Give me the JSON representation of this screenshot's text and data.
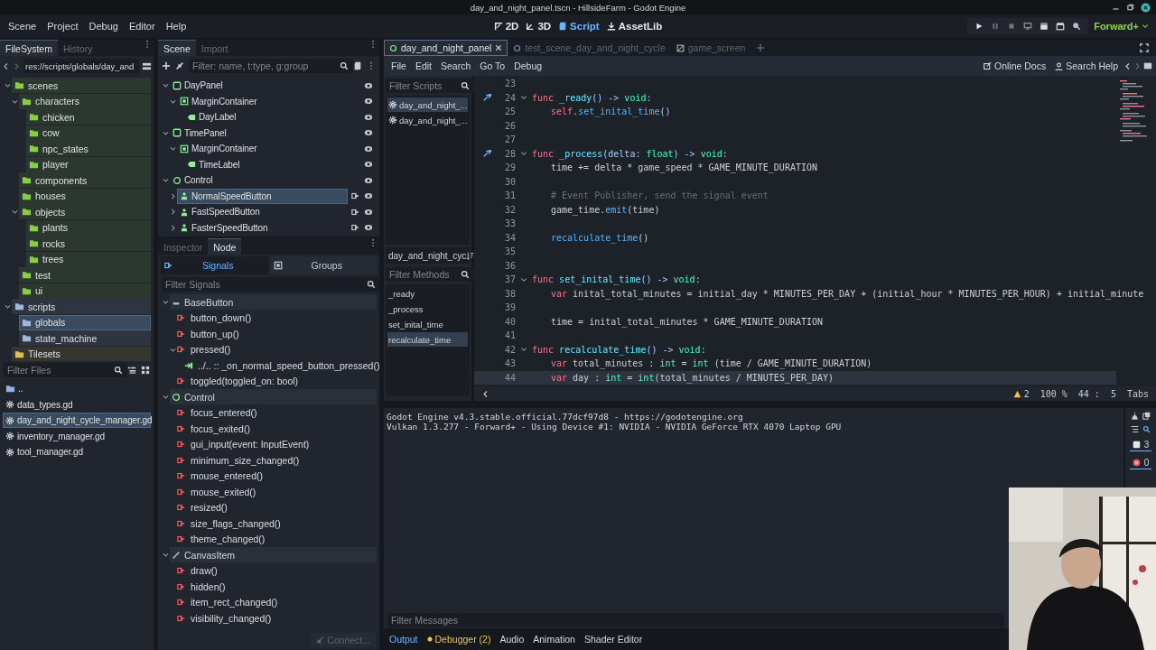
{
  "window": {
    "title": "day_and_night_panel.tscn - HillsideFarm - Godot Engine"
  },
  "menu": [
    "Scene",
    "Project",
    "Debug",
    "Editor",
    "Help"
  ],
  "workspaces": [
    {
      "label": "2D",
      "kind": "flat",
      "selected": false
    },
    {
      "label": "3D",
      "kind": "spatial",
      "selected": false
    },
    {
      "label": "Script",
      "kind": "script",
      "selected": true
    },
    {
      "label": "AssetLib",
      "kind": "assetlib",
      "selected": false
    }
  ],
  "renderer": "Forward+",
  "filesystem": {
    "tabs": [
      {
        "label": "FileSystem",
        "selected": true
      },
      {
        "label": "History",
        "selected": false
      }
    ],
    "path": "res://scripts/globals/day_and",
    "tree": [
      {
        "name": "scenes",
        "color": "#86d13f",
        "expanded": true,
        "selected": false,
        "children": [
          {
            "name": "characters",
            "expanded": true,
            "selected": false,
            "children": [
              {
                "name": "chicken",
                "selected": false
              },
              {
                "name": "cow",
                "selected": false
              },
              {
                "name": "npc_states",
                "selected": false
              },
              {
                "name": "player",
                "selected": false
              }
            ]
          },
          {
            "name": "components",
            "selected": false
          },
          {
            "name": "houses",
            "selected": false
          },
          {
            "name": "objects",
            "expanded": true,
            "selected": false,
            "children": [
              {
                "name": "plants",
                "selected": false
              },
              {
                "name": "rocks",
                "selected": false
              },
              {
                "name": "trees",
                "selected": false
              }
            ]
          },
          {
            "name": "test",
            "selected": false
          },
          {
            "name": "ui",
            "selected": false
          }
        ]
      },
      {
        "name": "scripts",
        "color": "#9fb8e0",
        "expanded": true,
        "selected": false,
        "children": [
          {
            "name": "globals",
            "selected": true
          },
          {
            "name": "state_machine",
            "selected": false
          }
        ]
      },
      {
        "name": "Tilesets",
        "color": "#e6c14a",
        "selected": false
      }
    ],
    "filter_placeholder": "Filter Files",
    "files": [
      {
        "name": "..",
        "kind": "folder",
        "selected": false
      },
      {
        "name": "data_types.gd",
        "kind": "script",
        "selected": false
      },
      {
        "name": "day_and_night_cycle_manager.gd",
        "kind": "script",
        "selected": true
      },
      {
        "name": "inventory_manager.gd",
        "kind": "script",
        "selected": false
      },
      {
        "name": "tool_manager.gd",
        "kind": "script",
        "selected": false
      }
    ]
  },
  "scene": {
    "tabs": [
      {
        "label": "Scene",
        "selected": true
      },
      {
        "label": "Import",
        "selected": false
      }
    ],
    "filter_placeholder": "Filter: name, t:type, g:group",
    "tree": [
      {
        "name": "DayPanel",
        "kind": "panel",
        "expanded": true,
        "selected": false,
        "connected": false,
        "children": [
          {
            "name": "MarginContainer",
            "kind": "container",
            "expanded": true,
            "selected": false,
            "connected": false,
            "children": [
              {
                "name": "DayLabel",
                "kind": "label",
                "selected": false,
                "connected": false
              }
            ]
          }
        ]
      },
      {
        "name": "TimePanel",
        "kind": "panel",
        "expanded": true,
        "selected": false,
        "connected": false,
        "children": [
          {
            "name": "MarginContainer",
            "kind": "container",
            "expanded": true,
            "selected": false,
            "connected": false,
            "children": [
              {
                "name": "TimeLabel",
                "kind": "label",
                "selected": false,
                "connected": false
              }
            ]
          }
        ]
      },
      {
        "name": "Control",
        "kind": "control",
        "expanded": true,
        "selected": false,
        "connected": false,
        "children": [
          {
            "name": "NormalSpeedButton",
            "kind": "button",
            "expanded": false,
            "selected": true,
            "connected": true
          },
          {
            "name": "FastSpeedButton",
            "kind": "button",
            "expanded": false,
            "selected": false,
            "connected": true
          },
          {
            "name": "FasterSpeedButton",
            "kind": "button",
            "expanded": false,
            "selected": false,
            "connected": true
          }
        ]
      }
    ]
  },
  "node_dock": {
    "tabs": [
      {
        "label": "Inspector",
        "selected": false
      },
      {
        "label": "Node",
        "selected": true
      }
    ],
    "modes": [
      {
        "label": "Signals",
        "kind": "signals",
        "selected": true
      },
      {
        "label": "Groups",
        "kind": "groups",
        "selected": false
      }
    ],
    "filter_placeholder": "Filter Signals",
    "groups": [
      {
        "name": "BaseButton",
        "kind": "basebutton",
        "expanded": true,
        "signals": [
          {
            "name": "button_down()"
          },
          {
            "name": "button_up()"
          },
          {
            "name": "pressed()",
            "expanded": true,
            "children": [
              {
                "name": "../.. :: _on_normal_speed_button_pressed()"
              }
            ]
          },
          {
            "name": "toggled(toggled_on: bool)"
          }
        ]
      },
      {
        "name": "Control",
        "kind": "control",
        "expanded": true,
        "signals": [
          {
            "name": "focus_entered()"
          },
          {
            "name": "focus_exited()"
          },
          {
            "name": "gui_input(event: InputEvent)"
          },
          {
            "name": "minimum_size_changed()"
          },
          {
            "name": "mouse_entered()"
          },
          {
            "name": "mouse_exited()"
          },
          {
            "name": "resized()"
          },
          {
            "name": "size_flags_changed()"
          },
          {
            "name": "theme_changed()"
          }
        ]
      },
      {
        "name": "CanvasItem",
        "kind": "canvasitem",
        "expanded": true,
        "signals": [
          {
            "name": "draw()"
          },
          {
            "name": "hidden()"
          },
          {
            "name": "item_rect_changed()"
          },
          {
            "name": "visibility_changed()"
          }
        ]
      }
    ],
    "connect": {
      "label": "Connect...",
      "disabled": true
    }
  },
  "script_editor": {
    "tabs": [
      {
        "label": "day_and_night_panel",
        "kind": "scene",
        "selected": true
      },
      {
        "label": "test_scene_day_and_night_cycle",
        "kind": "scene",
        "selected": false
      },
      {
        "label": "game_screen",
        "kind": "script",
        "selected": false
      }
    ],
    "menu": [
      "File",
      "Edit",
      "Search",
      "Go To",
      "Debug"
    ],
    "help": [
      {
        "label": "Online Docs",
        "kind": "docs"
      },
      {
        "label": "Search Help",
        "kind": "help"
      }
    ],
    "scripts_placeholder": "Filter Scripts",
    "scripts": [
      {
        "name": "day_and_night_...",
        "selected": true
      },
      {
        "name": "day_and_night_...",
        "selected": false
      }
    ],
    "current_script": "day_and_night_cyc",
    "methods_placeholder": "Filter Methods",
    "methods": [
      {
        "name": "_ready",
        "selected": false
      },
      {
        "name": "_process",
        "selected": false
      },
      {
        "name": "set_inital_time",
        "selected": false
      },
      {
        "name": "recalculate_time",
        "selected": true
      }
    ],
    "lines": [
      {
        "number": "23",
        "connected": false,
        "foldable": false,
        "current": false
      },
      {
        "number": "24",
        "connected": true,
        "foldable": true,
        "current": false,
        "indented": false,
        "code": [
          {
            "kind": "keyword",
            "text": "func "
          },
          {
            "kind": "function",
            "text": "_ready"
          },
          {
            "kind": "symbol",
            "text": "() -> "
          },
          {
            "kind": "type",
            "text": "void"
          },
          {
            "kind": "symbol",
            "text": ":"
          }
        ]
      },
      {
        "number": "25",
        "connected": false,
        "foldable": false,
        "current": false,
        "indented": true,
        "code": [
          {
            "kind": "keyword",
            "text": "self"
          },
          {
            "kind": "symbol",
            "text": "."
          },
          {
            "kind": "call",
            "text": "set_inital_time"
          },
          {
            "kind": "symbol",
            "text": "()"
          }
        ]
      },
      {
        "number": "26",
        "connected": false,
        "foldable": false,
        "current": false
      },
      {
        "number": "27",
        "connected": false,
        "foldable": false,
        "current": false
      },
      {
        "number": "28",
        "connected": true,
        "foldable": true,
        "current": false,
        "indented": false,
        "code": [
          {
            "kind": "keyword",
            "text": "func "
          },
          {
            "kind": "function",
            "text": "_process"
          },
          {
            "kind": "symbol",
            "text": "(delta: "
          },
          {
            "kind": "type",
            "text": "float"
          },
          {
            "kind": "symbol",
            "text": ") -> "
          },
          {
            "kind": "type",
            "text": "void"
          },
          {
            "kind": "symbol",
            "text": ":"
          }
        ]
      },
      {
        "number": "29",
        "connected": false,
        "foldable": false,
        "current": false,
        "indented": true,
        "code": [
          {
            "kind": "plain",
            "text": "time += delta * game_speed * GAME_MINUTE_DURATION"
          }
        ]
      },
      {
        "number": "30",
        "connected": false,
        "foldable": false,
        "current": false
      },
      {
        "number": "31",
        "connected": false,
        "foldable": false,
        "current": false,
        "indented": true,
        "code": [
          {
            "kind": "comment",
            "text": "# Event Publisher, send the signal event"
          }
        ]
      },
      {
        "number": "32",
        "connected": false,
        "foldable": false,
        "current": false,
        "indented": true,
        "code": [
          {
            "kind": "plain",
            "text": "game_time."
          },
          {
            "kind": "call",
            "text": "emit"
          },
          {
            "kind": "plain",
            "text": "(time)"
          }
        ]
      },
      {
        "number": "33",
        "connected": false,
        "foldable": false,
        "current": false
      },
      {
        "number": "34",
        "connected": false,
        "foldable": false,
        "current": false,
        "indented": true,
        "code": [
          {
            "kind": "call",
            "text": "recalculate_time"
          },
          {
            "kind": "plain",
            "text": "()"
          }
        ]
      },
      {
        "number": "35",
        "connected": false,
        "foldable": false,
        "current": false
      },
      {
        "number": "36",
        "connected": false,
        "foldable": false,
        "current": false
      },
      {
        "number": "37",
        "connected": false,
        "foldable": true,
        "current": false,
        "indented": false,
        "code": [
          {
            "kind": "keyword",
            "text": "func "
          },
          {
            "kind": "function",
            "text": "set_inital_time"
          },
          {
            "kind": "symbol",
            "text": "() -> "
          },
          {
            "kind": "type",
            "text": "void"
          },
          {
            "kind": "symbol",
            "text": ":"
          }
        ]
      },
      {
        "number": "38",
        "connected": false,
        "foldable": false,
        "current": false,
        "indented": true,
        "code": [
          {
            "kind": "keyword",
            "text": "var"
          },
          {
            "kind": "plain",
            "text": " inital_total_minutes = initial_day * MINUTES_PER_DAY + (initial_hour * MINUTES_PER_HOUR) + initial_minute"
          }
        ]
      },
      {
        "number": "39",
        "connected": false,
        "foldable": false,
        "current": false
      },
      {
        "number": "40",
        "connected": false,
        "foldable": false,
        "current": false,
        "indented": true,
        "code": [
          {
            "kind": "plain",
            "text": "time = inital_total_minutes * GAME_MINUTE_DURATION"
          }
        ]
      },
      {
        "number": "41",
        "connected": false,
        "foldable": false,
        "current": false
      },
      {
        "number": "42",
        "connected": false,
        "foldable": true,
        "current": false,
        "indented": false,
        "code": [
          {
            "kind": "keyword",
            "text": "func "
          },
          {
            "kind": "function",
            "text": "recalculate_time"
          },
          {
            "kind": "symbol",
            "text": "() -> "
          },
          {
            "kind": "type",
            "text": "void"
          },
          {
            "kind": "symbol",
            "text": ":"
          }
        ]
      },
      {
        "number": "43",
        "connected": false,
        "foldable": false,
        "current": false,
        "indented": true,
        "code": [
          {
            "kind": "keyword",
            "text": "var"
          },
          {
            "kind": "plain",
            "text": " total_minutes : "
          },
          {
            "kind": "type",
            "text": "int"
          },
          {
            "kind": "plain",
            "text": " = "
          },
          {
            "kind": "type",
            "text": "int"
          },
          {
            "kind": "plain",
            "text": " (time / GAME_MINUTE_DURATION)"
          }
        ]
      },
      {
        "number": "44",
        "connected": false,
        "foldable": false,
        "current": true,
        "indented": true,
        "code": [
          {
            "kind": "keyword",
            "text": "var"
          },
          {
            "kind": "plain",
            "text": " day : "
          },
          {
            "kind": "type",
            "text": "int"
          },
          {
            "kind": "plain",
            "text": " = "
          },
          {
            "kind": "type",
            "text": "int"
          },
          {
            "kind": "plain",
            "text": "(total_minutes / MINUTES_PER_DAY)"
          }
        ]
      }
    ],
    "status": {
      "warnings": "2",
      "zoom": "100 %",
      "line": "44 :",
      "column": "5",
      "indent": "Tabs"
    }
  },
  "output": {
    "lines": [
      "Godot Engine v4.3.stable.official.77dcf97d8 - https://godotengine.org",
      "Vulkan 1.3.277 - Forward+ - Using Device #1: NVIDIA - NVIDIA GeForce RTX 4070 Laptop GPU"
    ],
    "message_count": "3",
    "error_count": "0",
    "filter_placeholder": "Filter Messages"
  },
  "bottom_tabs": [
    {
      "label": "Output",
      "selected": true,
      "alert": false
    },
    {
      "label": "Debugger (2)",
      "selected": false,
      "alert": true
    },
    {
      "label": "Audio",
      "selected": false,
      "alert": false
    },
    {
      "label": "Animation",
      "selected": false,
      "alert": false
    },
    {
      "label": "Shader Editor",
      "selected": false,
      "alert": false
    }
  ]
}
